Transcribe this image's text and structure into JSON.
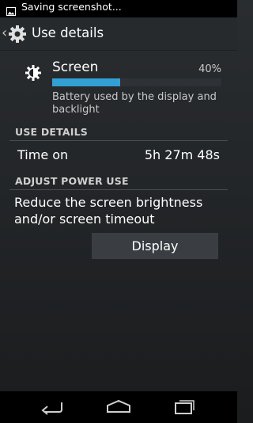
{
  "status_bar": {
    "notification_text": "Saving screenshot...",
    "notification_icon": "image-icon"
  },
  "action_bar": {
    "title": "Use details",
    "back_icon": "chevron-left-icon",
    "app_icon": "settings-gear-icon"
  },
  "usage_item": {
    "icon": "screen-brightness-icon",
    "title": "Screen",
    "percent_text": "40%",
    "percent_value": 40,
    "description": "Battery used by the display and backlight",
    "bar_color": "#33a0d5"
  },
  "use_details": {
    "header": "USE DETAILS",
    "time_on_label": "Time on",
    "time_on_value": "5h 27m 48s"
  },
  "adjust_power": {
    "header": "ADJUST POWER USE",
    "suggestion": "Reduce the screen brightness and/or screen timeout",
    "button_label": "Display"
  },
  "nav_bar": {
    "back_icon": "back-icon",
    "home_icon": "home-icon",
    "recents_icon": "recents-icon"
  }
}
